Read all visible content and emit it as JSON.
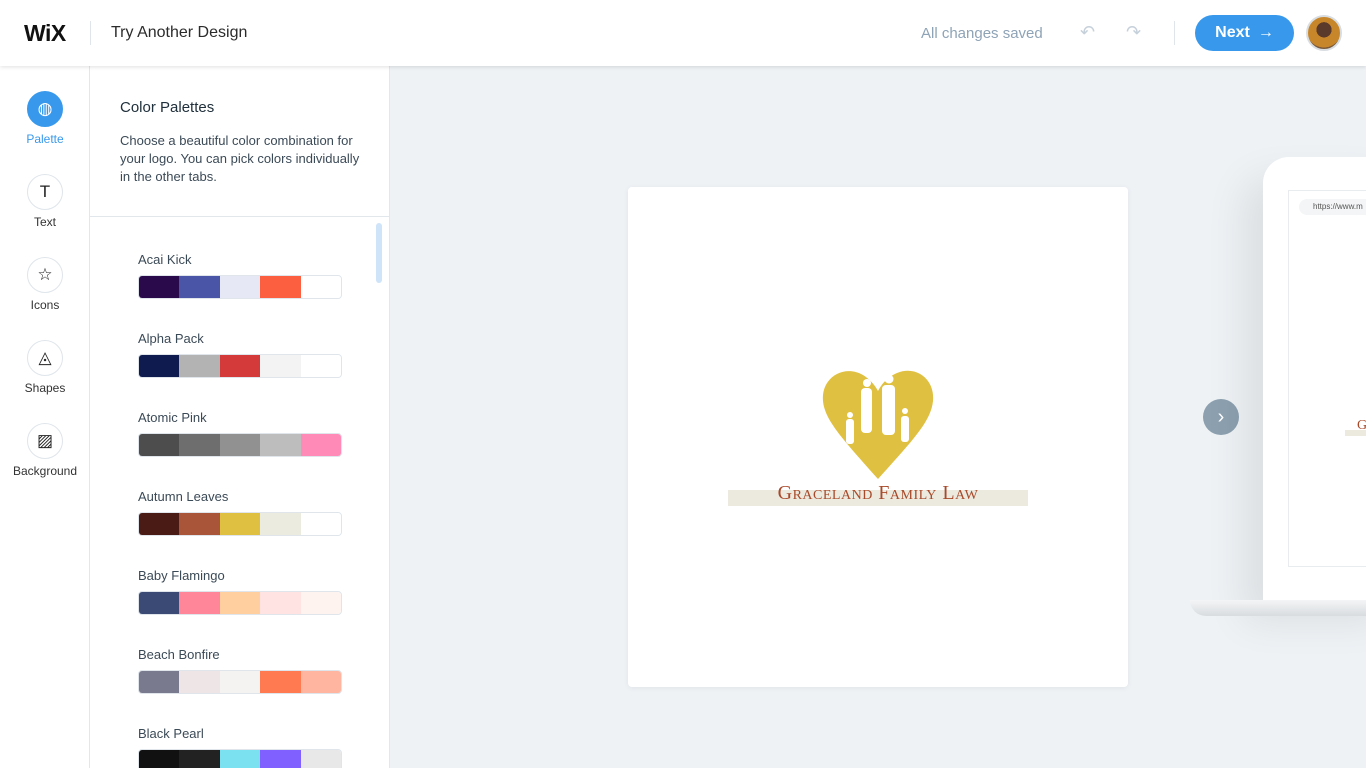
{
  "header": {
    "logo": "WiX",
    "title": "Try Another Design",
    "status": "All changes saved",
    "undo_icon": "undo-icon",
    "redo_icon": "redo-icon",
    "next_label": "Next",
    "next_arrow": "→"
  },
  "rail": [
    {
      "label": "Palette",
      "icon": "◍",
      "active": true
    },
    {
      "label": "Text",
      "icon": "T"
    },
    {
      "label": "Icons",
      "icon": "☆"
    },
    {
      "label": "Shapes",
      "icon": "◬"
    },
    {
      "label": "Background",
      "icon": "▨"
    }
  ],
  "panel": {
    "title": "Color Palettes",
    "description": "Choose a beautiful color combination for your logo. You can pick colors individually in the other tabs.",
    "palettes": [
      {
        "name": "Acai Kick",
        "colors": [
          "#2a0a4a",
          "#4a55a8",
          "#e6e8f5",
          "#fc5f3f",
          "#ffffff"
        ]
      },
      {
        "name": "Alpha Pack",
        "colors": [
          "#0f1a4e",
          "#b3b3b3",
          "#d43a3a",
          "#f3f3f3",
          "#ffffff"
        ]
      },
      {
        "name": "Atomic Pink",
        "colors": [
          "#4d4d4d",
          "#6e6e6e",
          "#919191",
          "#bdbdbd",
          "#ff8ab8"
        ]
      },
      {
        "name": "Autumn Leaves",
        "colors": [
          "#4a1a15",
          "#a8553a",
          "#e0c040",
          "#ecebe0",
          "#ffffff"
        ]
      },
      {
        "name": "Baby Flamingo",
        "colors": [
          "#3a4a75",
          "#ff8599",
          "#ffcfa0",
          "#ffe2e2",
          "#fff3f0"
        ]
      },
      {
        "name": "Beach Bonfire",
        "colors": [
          "#7a7a8e",
          "#eee6e6",
          "#f4f3f1",
          "#ff7a50",
          "#ffb59f"
        ]
      },
      {
        "name": "Black Pearl",
        "colors": [
          "#111111",
          "#222222",
          "#7be0f0",
          "#8060ff",
          "#e8e8e8"
        ]
      }
    ]
  },
  "preview": {
    "logo_text": "Graceland Family Law",
    "heart_color": "#e0c040",
    "text_color": "#a84a2a",
    "mockup_url": "https://www.m",
    "mockup_text": "G"
  },
  "colors": {
    "accent": "#3899ec"
  }
}
